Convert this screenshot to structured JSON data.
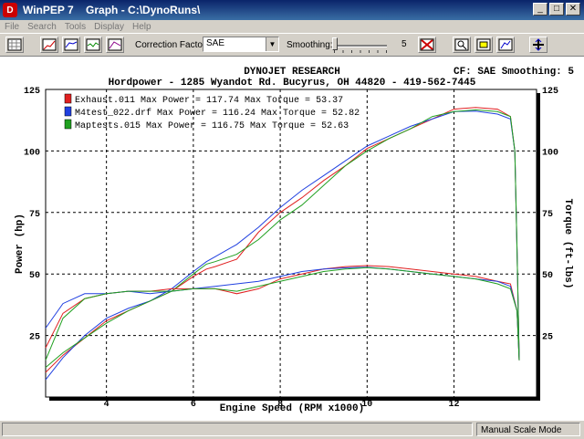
{
  "window": {
    "app_name": "WinPEP 7",
    "document": "Graph - C:\\DynoRuns\\",
    "icon": "dynojet-app-icon"
  },
  "menu": {
    "items": [
      "File",
      "Search",
      "Tools",
      "Display",
      "Help"
    ]
  },
  "toolbar": {
    "correction_factor_label": "Correction Factor:",
    "correction_factor_value": "SAE",
    "smoothing_label": "Smoothing:",
    "smoothing_value": "5"
  },
  "chart_header": {
    "company": "DYNOJET RESEARCH",
    "cf_info": "CF: SAE  Smoothing: 5",
    "address": "Hordpower - 1285 Wyandot Rd. Bucyrus, OH  44820 - 419-562-7445"
  },
  "status": {
    "mode": "Manual Scale Mode"
  },
  "chart_data": {
    "type": "line",
    "xlabel": "Engine Speed (RPM x1000)",
    "ylabel_left": "Power (hp)",
    "ylabel_right": "Torque (ft-lbs)",
    "xlim": [
      2.6,
      13.9
    ],
    "ylim": [
      0,
      125
    ],
    "x_ticks": [
      "4",
      "6",
      "8",
      "10",
      "12"
    ],
    "y_ticks": [
      "25",
      "50",
      "75",
      "100",
      "125"
    ],
    "grid": true,
    "legend": [
      {
        "file": "Exhaust.011",
        "max_power": "117.74",
        "max_torque": "53.37",
        "color": "#e02020"
      },
      {
        "file": "M4test_022.drf",
        "max_power": "116.24",
        "max_torque": "52.82",
        "color": "#2040e0"
      },
      {
        "file": "Maptests.015",
        "max_power": "116.75",
        "max_torque": "52.63",
        "color": "#20a020"
      }
    ],
    "series": [
      {
        "name": "Exhaust.011",
        "measure": "power",
        "x": [
          2.6,
          3.0,
          3.5,
          4.0,
          4.5,
          5.0,
          5.5,
          6.0,
          6.3,
          6.5,
          7.0,
          7.5,
          8.0,
          8.5,
          9.0,
          9.5,
          10.0,
          10.5,
          11.0,
          11.5,
          12.0,
          12.5,
          13.0,
          13.3,
          13.4,
          13.45,
          13.5
        ],
        "y": [
          10,
          17,
          24,
          31,
          35,
          39,
          43,
          49,
          52,
          53,
          56,
          67,
          75,
          81,
          88,
          94,
          101,
          105,
          109,
          113,
          117,
          117.7,
          117,
          114,
          100,
          60,
          15
        ]
      },
      {
        "name": "M4test_022.drf",
        "measure": "power",
        "x": [
          2.6,
          3.0,
          3.5,
          4.0,
          4.5,
          5.0,
          5.5,
          6.0,
          6.3,
          6.5,
          7.0,
          7.5,
          8.0,
          8.5,
          9.0,
          9.5,
          10.0,
          10.5,
          11.0,
          11.5,
          12.0,
          12.5,
          13.0,
          13.3,
          13.4,
          13.45,
          13.5
        ],
        "y": [
          7,
          16,
          25,
          32,
          36,
          39,
          44,
          51,
          55,
          57,
          62,
          69,
          77,
          84,
          90,
          96,
          102,
          106,
          110,
          113,
          116,
          116.2,
          115,
          113,
          100,
          60,
          15
        ]
      },
      {
        "name": "Maptests.015",
        "measure": "power",
        "x": [
          2.6,
          3.0,
          3.5,
          4.0,
          4.5,
          5.0,
          5.5,
          6.0,
          6.3,
          6.5,
          7.0,
          7.5,
          8.0,
          8.5,
          9.0,
          9.5,
          10.0,
          10.5,
          11.0,
          11.5,
          12.0,
          12.5,
          13.0,
          13.3,
          13.4,
          13.45,
          13.5
        ],
        "y": [
          12,
          18,
          24,
          30,
          35,
          39,
          43,
          50,
          54,
          55,
          58,
          64,
          72,
          78,
          86,
          94,
          100,
          105,
          109,
          114,
          116,
          116.7,
          116,
          114,
          100,
          60,
          15
        ]
      },
      {
        "name": "Exhaust.011",
        "measure": "torque",
        "x": [
          2.6,
          3.0,
          3.5,
          4.0,
          4.5,
          5.0,
          5.5,
          6.0,
          6.5,
          7.0,
          7.5,
          8.0,
          8.5,
          9.0,
          9.5,
          10.0,
          10.5,
          11.0,
          11.5,
          12.0,
          12.5,
          13.0,
          13.3,
          13.45,
          13.5
        ],
        "y": [
          20,
          34,
          40,
          42,
          43,
          43,
          44,
          44,
          44,
          42,
          44,
          48,
          50,
          52,
          53,
          53.4,
          53,
          52,
          51,
          50,
          49,
          47,
          46,
          35,
          15
        ]
      },
      {
        "name": "M4test_022.drf",
        "measure": "torque",
        "x": [
          2.6,
          3.0,
          3.5,
          4.0,
          4.5,
          5.0,
          5.5,
          6.0,
          6.5,
          7.0,
          7.5,
          8.0,
          8.5,
          9.0,
          9.5,
          10.0,
          10.5,
          11.0,
          11.5,
          12.0,
          12.5,
          13.0,
          13.3,
          13.45,
          13.5
        ],
        "y": [
          28,
          38,
          42,
          42,
          43,
          42,
          43,
          44,
          45,
          46,
          47,
          49,
          51,
          52,
          52.5,
          52.8,
          52,
          51,
          50,
          49,
          48,
          47,
          45,
          35,
          15
        ]
      },
      {
        "name": "Maptests.015",
        "measure": "torque",
        "x": [
          2.6,
          3.0,
          3.5,
          4.0,
          4.5,
          5.0,
          5.5,
          6.0,
          6.5,
          7.0,
          7.5,
          8.0,
          8.5,
          9.0,
          9.5,
          10.0,
          10.5,
          11.0,
          11.5,
          12.0,
          12.5,
          13.0,
          13.3,
          13.45,
          13.5
        ],
        "y": [
          15,
          32,
          40,
          42,
          43,
          43,
          43,
          44,
          44,
          43,
          45,
          47,
          49,
          51,
          52,
          52.6,
          52,
          51,
          50,
          49,
          48,
          46,
          44,
          35,
          15
        ]
      }
    ]
  }
}
